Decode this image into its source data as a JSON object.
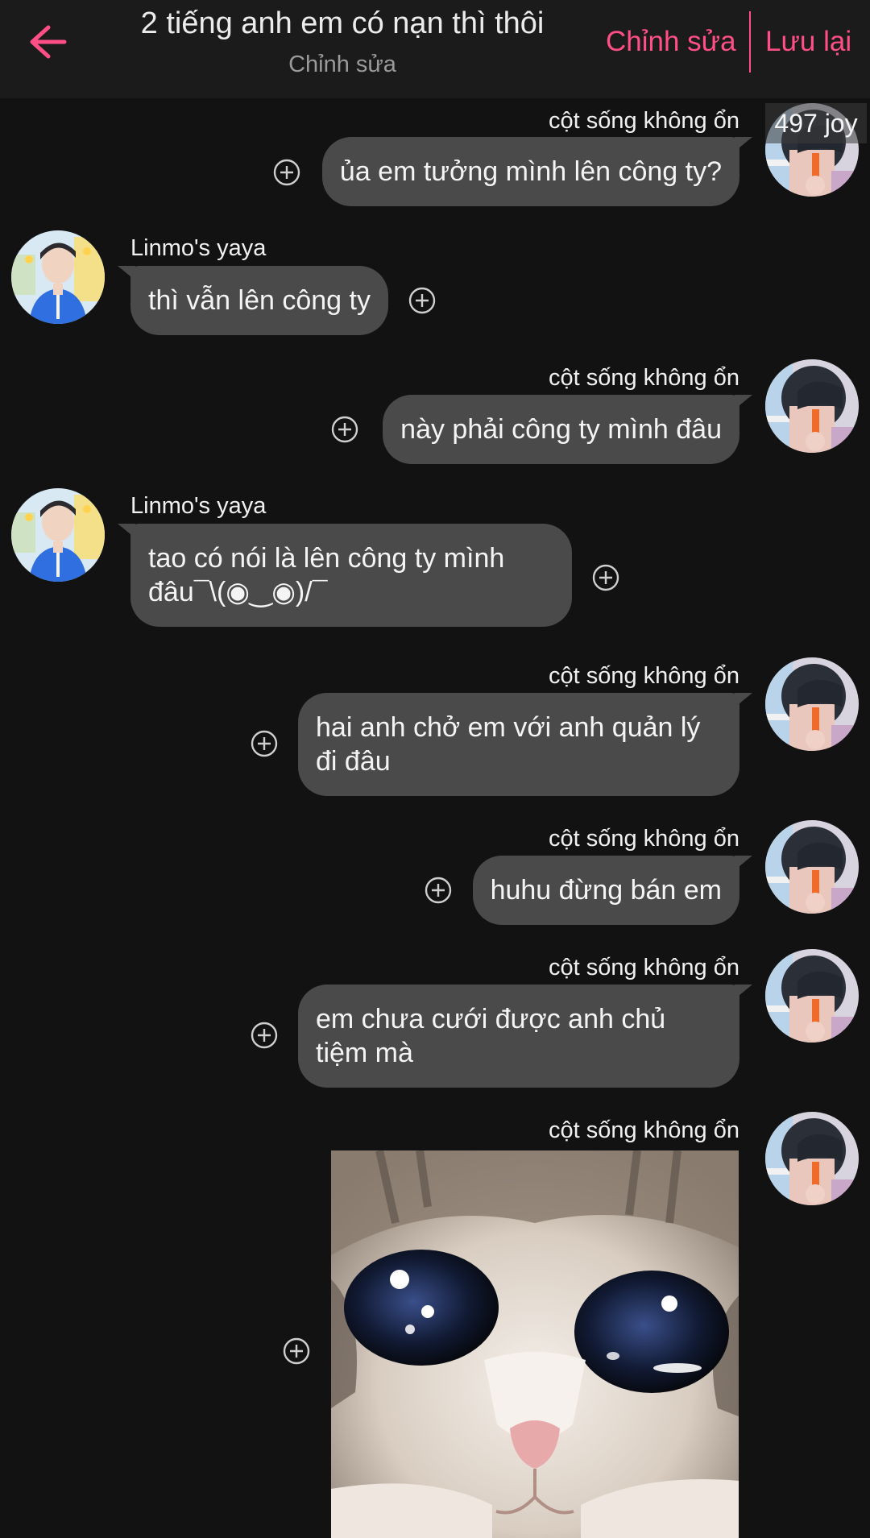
{
  "header": {
    "title": "2 tiếng anh em có nạn thì thôi",
    "subtitle": "Chỉnh sửa",
    "edit_label": "Chỉnh sửa",
    "save_label": "Lưu lại"
  },
  "overlay_label": "497 joy",
  "messages": [
    {
      "sender": "cột sống không ổn",
      "text": "ủa em tưởng mình lên công ty?"
    },
    {
      "sender": "Linmo's yaya",
      "text": "thì vẫn lên công ty"
    },
    {
      "sender": "cột sống không ổn",
      "text": "này phải công ty mình đâu"
    },
    {
      "sender": "Linmo's yaya",
      "text": "tao có nói là lên công ty mình đâu¯\\(◉‿◉)/¯"
    },
    {
      "sender": "cột sống không ổn",
      "text": "hai anh chở em với anh quản lý đi đâu"
    },
    {
      "sender": "cột sống không ổn",
      "text": "huhu đừng bán em"
    },
    {
      "sender": "cột sống không ổn",
      "text": "em chưa cưới được anh chủ tiệm mà"
    },
    {
      "sender": "cột sống không ổn",
      "text": ""
    }
  ],
  "colors": {
    "accent": "#ff4f86",
    "background": "#121212",
    "header": "#1b1b1b",
    "bubble": "#4a4a4a"
  },
  "icons": [
    "back-arrow-icon",
    "add-circle-icon"
  ]
}
